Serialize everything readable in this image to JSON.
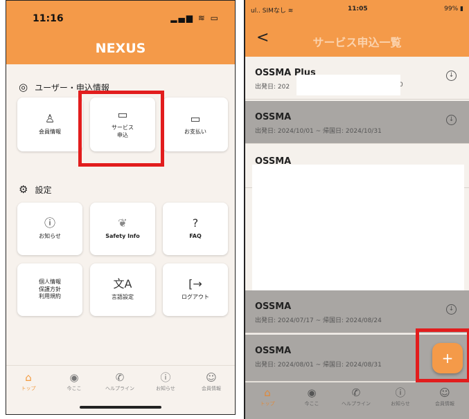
{
  "left_phone": {
    "status_time": "11:16",
    "status_icons": "▂▄▆ ≋ ▭",
    "brand": "NEXUS",
    "section_user": {
      "icon": "user-circle-icon",
      "title": "ユーザー・申込情報"
    },
    "user_cards": [
      {
        "icon": "person-icon",
        "label": "会員情報"
      },
      {
        "icon": "book-icon",
        "label": "サービス\n申込"
      },
      {
        "icon": "card-icon",
        "label": "お支払い"
      }
    ],
    "section_settings": {
      "icon": "gear-icon",
      "title": "設定"
    },
    "settings_cards": [
      {
        "icon": "info-icon",
        "label": "お知らせ"
      },
      {
        "icon": "hands-icon",
        "label": "Safety Info"
      },
      {
        "icon": "question-icon",
        "label": "FAQ"
      },
      {
        "icon": "",
        "label": "個人情報\n保護方針\n利用規約"
      },
      {
        "icon": "translate-icon",
        "label": "言語設定"
      },
      {
        "icon": "logout-icon",
        "label": "ログアウト"
      }
    ],
    "tabs": [
      {
        "icon": "home-icon",
        "label": "トップ",
        "active": true
      },
      {
        "icon": "location-icon",
        "label": "今ここ"
      },
      {
        "icon": "phone-icon",
        "label": "ヘルプライン"
      },
      {
        "icon": "info-icon",
        "label": "お知らせ"
      },
      {
        "icon": "account-icon",
        "label": "会員情報"
      }
    ]
  },
  "right_phone": {
    "status_left": "ul.. SIMなし ≋",
    "status_time": "11:05",
    "status_right": "99% ▮",
    "back_label": "<",
    "title": "サービス申込一覧",
    "rows": [
      {
        "name": "OSSMA Plus",
        "date": "出発日: 202",
        "date_tail": "0",
        "state": "light"
      },
      {
        "name": "OSSMA",
        "date": "出発日: 2024/10/01 ~ 帰国日: 2024/10/31",
        "state": "grey"
      },
      {
        "name": "OSSMA",
        "date": "",
        "state": "light"
      },
      {
        "name": "OSSMA",
        "date": "出発日: 2024/07/17 ~ 帰国日: 2024/08/24",
        "state": "grey"
      },
      {
        "name": "OSSMA",
        "date": "出発日: 2024/08/01 ~ 帰国日: 2024/08/31",
        "state": "grey"
      }
    ],
    "fab_label": "+",
    "tabs": [
      {
        "icon": "home-icon",
        "label": "トップ",
        "active": true
      },
      {
        "icon": "location-icon",
        "label": "今ここ"
      },
      {
        "icon": "phone-icon",
        "label": "ヘルプライン"
      },
      {
        "icon": "info-icon",
        "label": "お知らせ"
      },
      {
        "icon": "account-icon",
        "label": "会員情報"
      }
    ]
  }
}
